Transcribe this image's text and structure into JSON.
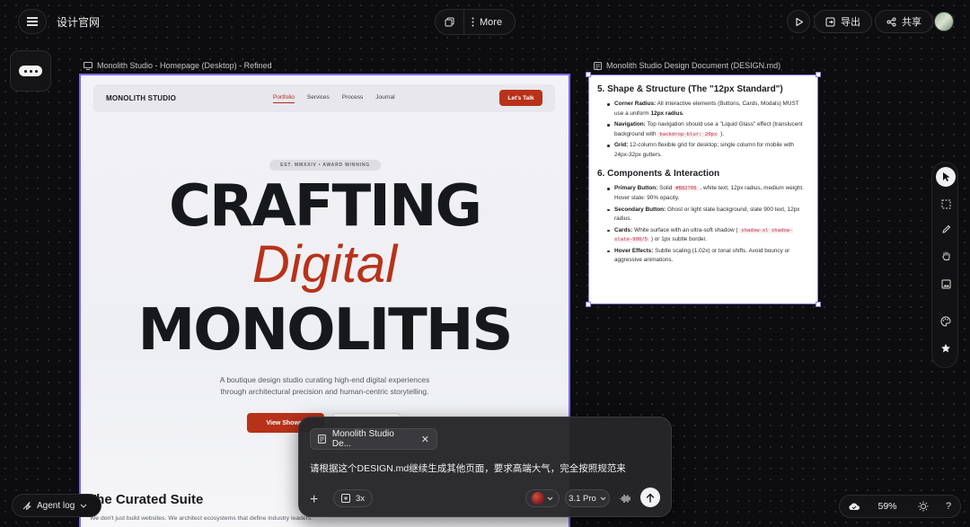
{
  "topbar": {
    "app_title": "设计官网",
    "more_label": "More",
    "export_label": "导出",
    "share_label": "共享"
  },
  "frames": {
    "homepage_label": "Monolith Studio - Homepage (Desktop) - Refined",
    "doc_label": "Monolith Studio Design Document (DESIGN.md)"
  },
  "homepage": {
    "logo": "MONOLITH STUDIO",
    "nav_links": [
      "Portfolio",
      "Services",
      "Process",
      "Journal"
    ],
    "cta": "Let's Talk",
    "badge": "EST. MMXXIV • AWARD WINNING",
    "hero_line1": "CRAFTING",
    "hero_line2": "Digital",
    "hero_line3": "MONOLITHS",
    "subtitle_line1": "A boutique design studio curating high-end digital experiences",
    "subtitle_line2": "through architectural precision and human-centric storytelling.",
    "primary_button": "View Showre",
    "section_title": "The Curated Suite",
    "section_sub": "We don't just build websites. We architect ecosystems that define industry leaders."
  },
  "design_doc": {
    "section5_title": "5. Shape & Structure (The \"12px Standard\")",
    "s5": {
      "corner_label": "Corner Radius:",
      "corner_text": "All interactive elements (Buttons, Cards, Modals) MUST use a uniform",
      "corner_strong": "12px radius",
      "nav_label": "Navigation:",
      "nav_text": "Top navigation should use a \"Liquid Glass\" effect (translucent background with",
      "nav_code": "backdrop-blur: 20px",
      "grid_label": "Grid:",
      "grid_text": "12-column flexible grid for desktop; single column for mobile with 24px-32px gutters."
    },
    "section6_title": "6. Components & Interaction",
    "s6": {
      "primary_label": "Primary Button:",
      "primary_pre": "Solid",
      "primary_code": "#B82706",
      "primary_post": ", white text, 12px radius, medium weight. Hover state: 90% opacity.",
      "secondary_label": "Secondary Button:",
      "secondary_text": "Ghost or light slate background, slate 900 text, 12px radius.",
      "cards_label": "Cards:",
      "cards_pre": "White surface with an ultra-soft shadow (",
      "cards_code": "shadow-xl shadow-slate-900/5",
      "cards_post": ") or 1px subtle border.",
      "hover_label": "Hover Effects:",
      "hover_text": "Subtle scaling (1.02x) or tonal shifts. Avoid bouncy or aggressive animations."
    }
  },
  "chat": {
    "attachment": "Monolith Studio De...",
    "prompt": "请根据这个DESIGN.md继续生成其他页面，要求高端大气，完全按照规范来",
    "multiplier": "3x",
    "model": "3.1 Pro"
  },
  "agent_log_label": "Agent log",
  "zoom_label": "59%",
  "help_label": "?",
  "colors": {
    "accent": "#b8321a",
    "selection": "#7c6ae6",
    "background": "#0d0d0f"
  },
  "icons": [
    "menu-icon",
    "copy-icon",
    "more-dots-icon",
    "play-icon",
    "export-icon",
    "share-icon",
    "chat-bubble-icon",
    "cursor-icon",
    "frame-select-icon",
    "pen-icon",
    "hand-icon",
    "image-icon",
    "palette-icon",
    "star-icon",
    "plus-icon",
    "layers-icon",
    "chevron-down-icon",
    "voice-icon",
    "send-arrow-icon",
    "close-icon",
    "document-icon",
    "desktop-icon",
    "cloud-icon",
    "sun-icon"
  ]
}
